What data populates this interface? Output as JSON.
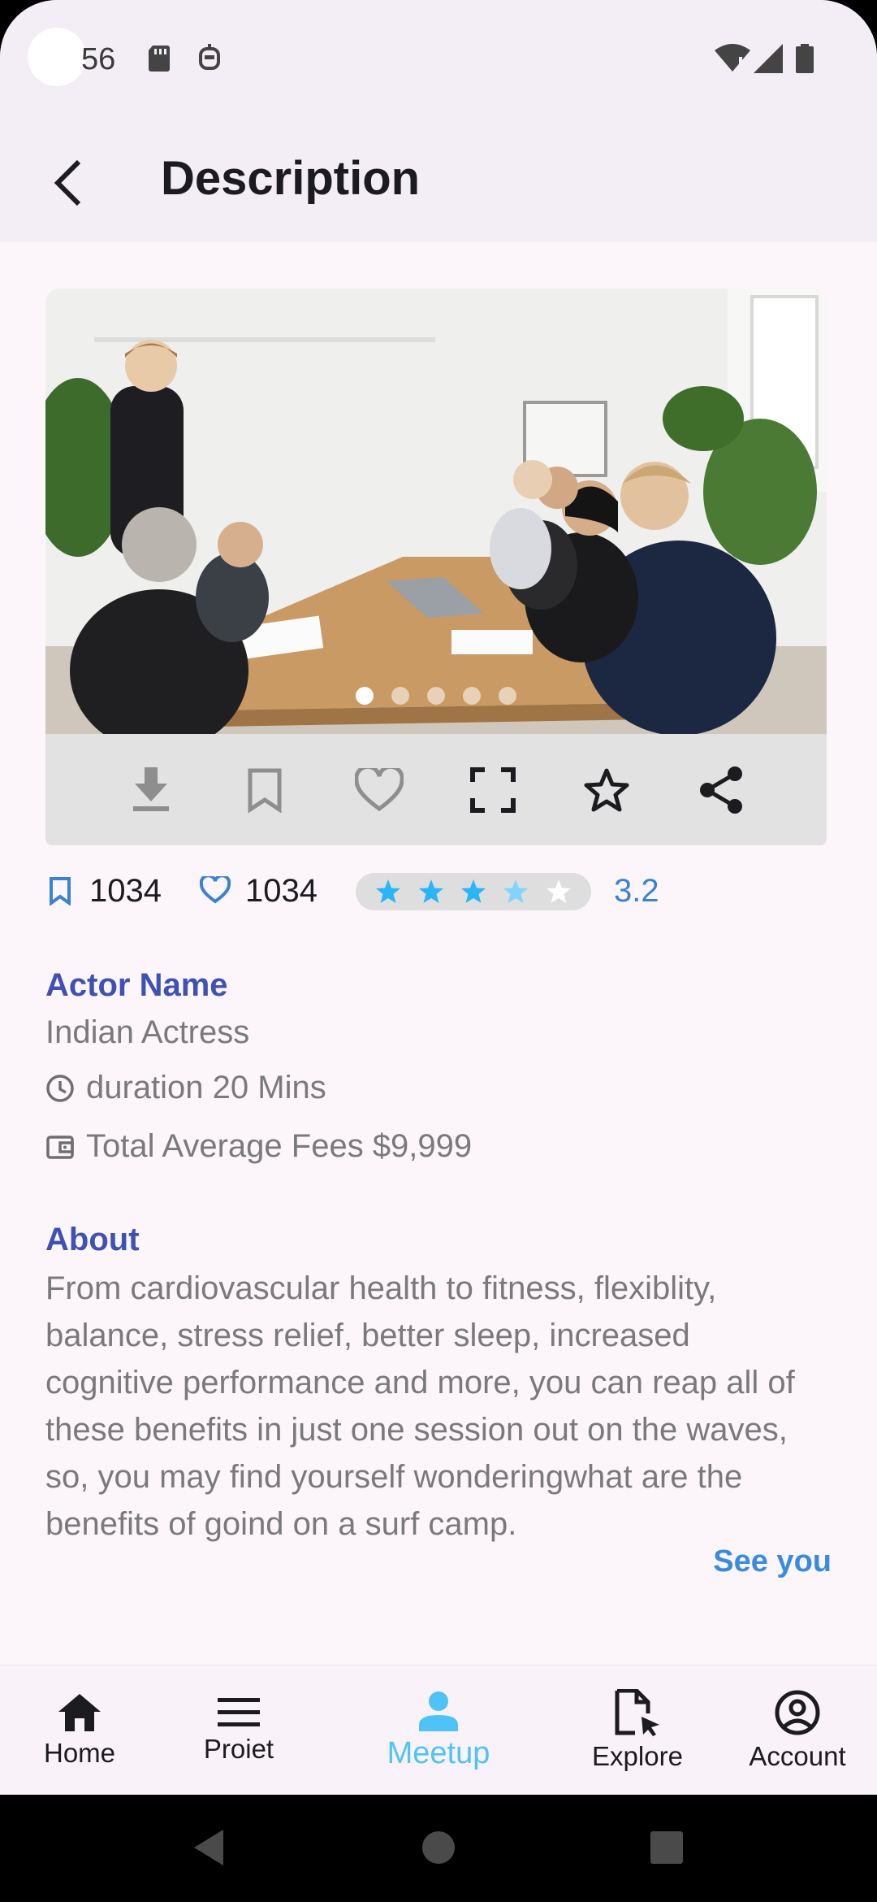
{
  "status_bar": {
    "time": "56"
  },
  "app_bar": {
    "title": "Description"
  },
  "carousel": {
    "slide_count": 5,
    "active_slide": 1
  },
  "stats": {
    "bookmarks": "1034",
    "likes": "1034",
    "rating": "3.2",
    "rating_value": 3.2,
    "rating_max": 5
  },
  "details": {
    "actor_heading": "Actor Name",
    "actor_value": "Indian Actress",
    "duration": "duration 20 Mins",
    "fees": "Total Average Fees $9,999"
  },
  "about": {
    "heading": "About",
    "text": "From cardiovascular health to fitness, flexiblity, balance, stress relief, better sleep, increased cognitive performance and more, you can reap all of these benefits in just one session out on the waves, so, you may find yourself wonderingwhat are the benefits of goind on a surf camp.",
    "link": "See you"
  },
  "bottom_nav": {
    "items": [
      {
        "label": "Home",
        "icon": "home-icon"
      },
      {
        "label": "Proiet",
        "icon": "menu-icon"
      },
      {
        "label": "Meetup",
        "icon": "person-icon"
      },
      {
        "label": "Explore",
        "icon": "file-cursor-icon"
      },
      {
        "label": "Account",
        "icon": "account-circle-icon"
      }
    ],
    "active_index": 2
  },
  "colors": {
    "accent_blue": "#3f51b5",
    "link_blue": "#3a8be0",
    "star_blue": "#29b6f6",
    "nav_active": "#4fc3f7"
  }
}
